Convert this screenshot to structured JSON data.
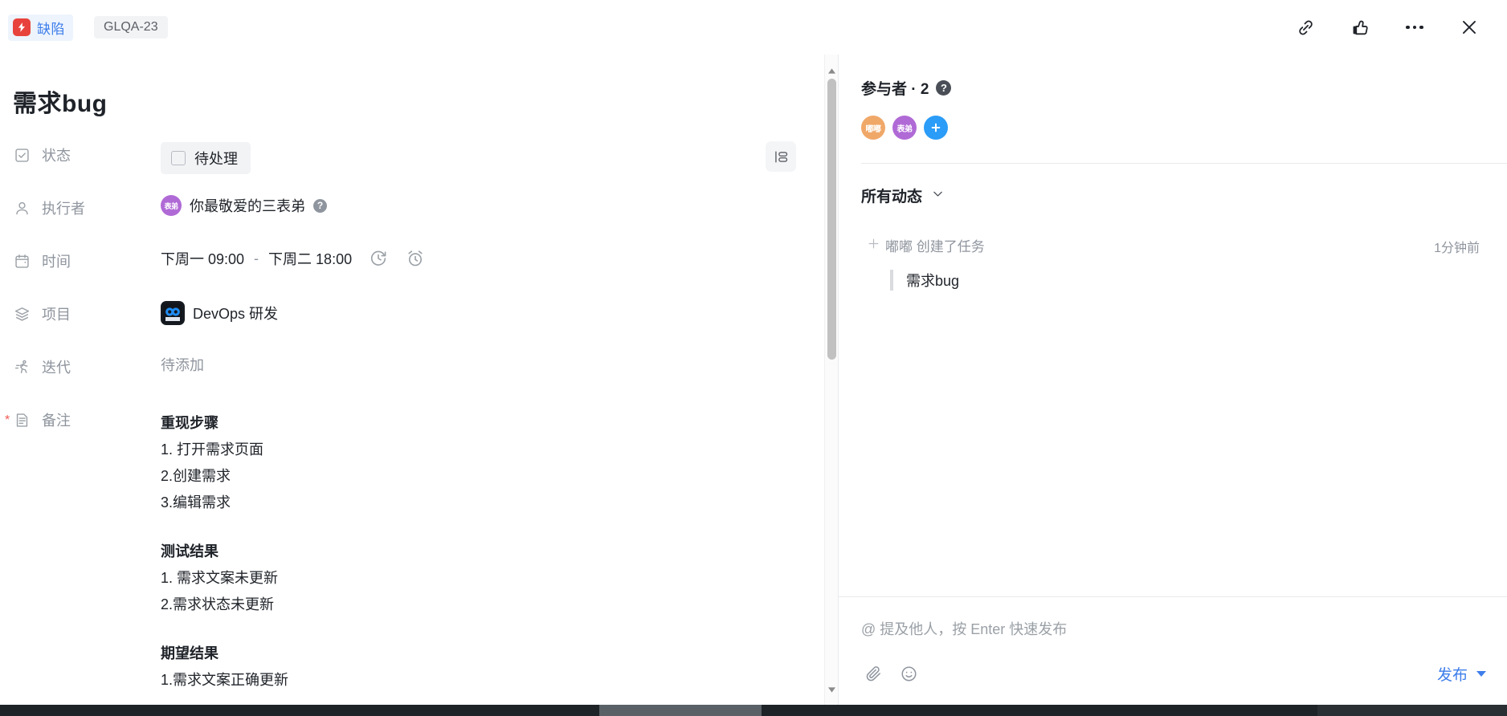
{
  "topbar": {
    "type_label": "缺陷",
    "issue_key": "GLQA-23",
    "actions": [
      {
        "name": "link-icon",
        "label": "复制链接"
      },
      {
        "name": "thumbs-up-icon",
        "label": "点赞"
      },
      {
        "name": "more-icon",
        "label": "更多"
      },
      {
        "name": "close-icon",
        "label": "关闭"
      }
    ]
  },
  "detail": {
    "title": "需求bug",
    "fields": {
      "status": {
        "label": "状态",
        "value": "待处理"
      },
      "assignee": {
        "label": "执行者",
        "value": "你最敬爱的三表弟",
        "avatar_text": "表弟",
        "avatar_color": "#b06ad6"
      },
      "time": {
        "label": "时间",
        "start": "下周一 09:00",
        "separator": "-",
        "end": "下周二 18:00"
      },
      "project": {
        "label": "项目",
        "value": "DevOps 研发"
      },
      "iteration": {
        "label": "迭代",
        "value": "待添加"
      },
      "remark": {
        "label": "备注",
        "required": true
      }
    },
    "remark_blocks": [
      {
        "type": "heading",
        "text": "重现步骤"
      },
      {
        "type": "line",
        "text": "1. 打开需求页面"
      },
      {
        "type": "line",
        "text": "2.创建需求"
      },
      {
        "type": "line",
        "text": "3.编辑需求"
      },
      {
        "type": "spacer",
        "text": ""
      },
      {
        "type": "heading",
        "text": "测试结果"
      },
      {
        "type": "line",
        "text": "1. 需求文案未更新"
      },
      {
        "type": "line",
        "text": "2.需求状态未更新"
      },
      {
        "type": "spacer",
        "text": ""
      },
      {
        "type": "heading",
        "text": "期望结果"
      },
      {
        "type": "line",
        "text": "1.需求文案正确更新"
      }
    ]
  },
  "sidebar_panel": {
    "participants": {
      "title": "参与者 · 2",
      "avatars": [
        {
          "text": "嘟嘟",
          "color": "#f0a869"
        },
        {
          "text": "表弟",
          "color": "#b06ad6"
        }
      ],
      "add_label": "+"
    },
    "activity": {
      "filter_label": "所有动态",
      "items": [
        {
          "actor": "嘟嘟",
          "action": "创建了任务",
          "quote": "需求bug",
          "time": "1分钟前"
        }
      ]
    },
    "composer": {
      "placeholder": "@ 提及他人，按 Enter 快速发布",
      "publish_label": "发布"
    }
  },
  "colors": {
    "accent_blue": "#3d7eea",
    "bug_red": "#e8423c",
    "add_blue": "#2b9cf7"
  }
}
